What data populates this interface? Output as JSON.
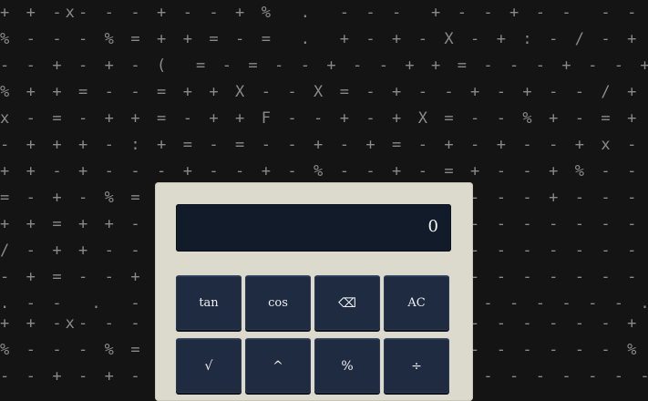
{
  "background_rows": [
    "+ + -x- - - + - - + %  .  - - -  + - - + - -  - - + - -  X  + - + - X - - + - - + -",
    "% - - - % = + + = - =  .  + - + - X - + : - / - + + - % - - % = + + = - = . + -",
    "- - + - + - (  = - = - - + - - + + = - - - + - - + - - - + - - + - -  ( = - = -",
    "% + + = - - = + + X - - X = - + - - + - + - - / + - % + + = - - = + + X - - X",
    "x - = - + + = - + + F - - + - + X = - - % + - = + x - = - + + = - + + F - -",
    "- + + + - : + = - = - - + - + = - + - + - - + x - = + - - : + = - = - - + - +",
    "+ + - + - - - + - - + - % - - + - = + - - + % - - + - + - - - + - - + - % - -",
    "= - + - % = - + - - - + - + - - - + - - - + - - - - - + = - + - % = - + - - -",
    "+ + = + + - + - = - - - - - - - - - - - - - - - - + + = + + - + - = - - - - -",
    "/ - + + - - + = + - - - - - - - - - - - - - - - - / - + + - - + = + - - - - -",
    "- + = - - + - - = - - - - - - - - - - - - - - - - - + = - - + - - = - - - - -",
    ". - -  .  - . - - - .  - - - - - - - - - - - - - . - -  .  - . - - - .  - -",
    "+ + -x- - - + - - + % - - - - - - - - - - - - - + + -x- - - + - - + % - - -",
    "% - - - % = + + = - = - - - - - - - - - - - - - % - - - % = + + = - = - - -",
    "- - + - + - (  = - = - - - - - - - - - - - - - - - + - + - (  = - = - - - -"
  ],
  "display": {
    "value": "0"
  },
  "keys": [
    {
      "label": "tan",
      "name": "tan-key"
    },
    {
      "label": "cos",
      "name": "cos-key"
    },
    {
      "label": "⌫",
      "name": "backspace-key"
    },
    {
      "label": "AC",
      "name": "all-clear-key"
    },
    {
      "label": "√",
      "name": "square-root-key"
    },
    {
      "label": "^",
      "name": "power-key"
    },
    {
      "label": "%",
      "name": "percent-key"
    },
    {
      "label": "÷",
      "name": "divide-key"
    }
  ]
}
